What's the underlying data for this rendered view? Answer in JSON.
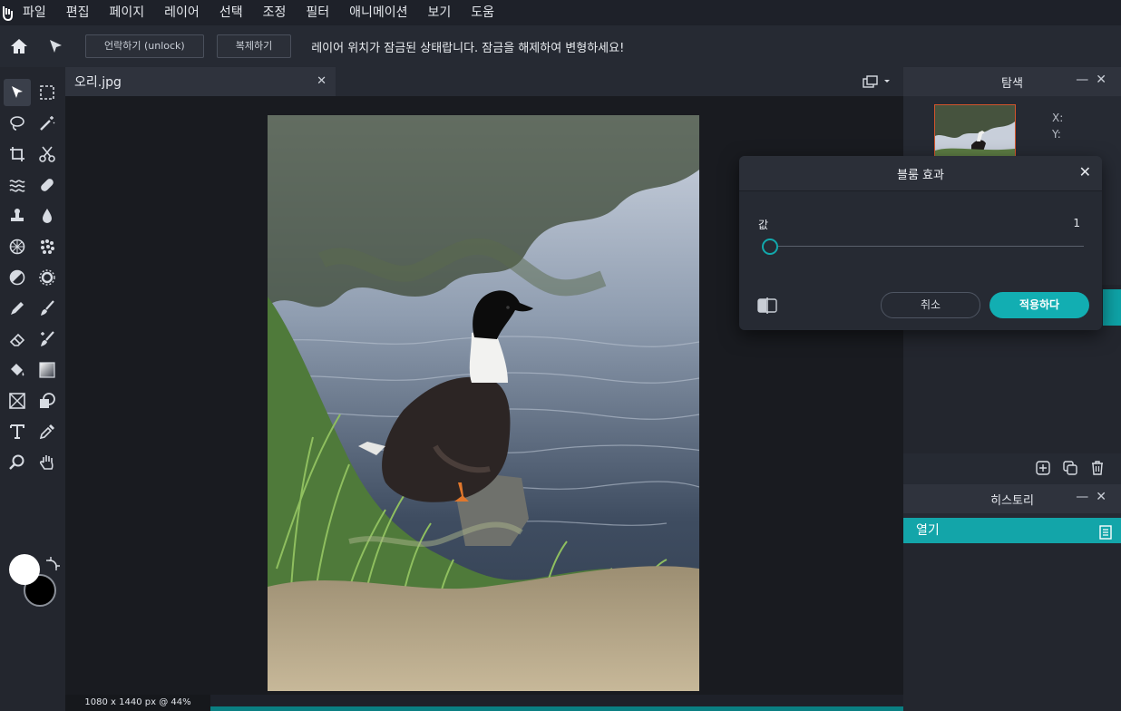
{
  "menu": [
    "파일",
    "편집",
    "페이지",
    "레이어",
    "선택",
    "조정",
    "필터",
    "애니메이션",
    "보기",
    "도움"
  ],
  "toolbar": {
    "unlock_label": "언락하기 (unlock)",
    "duplicate_label": "복제하기",
    "message": "레이어 위치가 잠금된 상태랍니다. 잠금을 해제하여 변형하세요!"
  },
  "document": {
    "tab_title": "오리.jpg",
    "status": "1080 x 1440 px @ 44%"
  },
  "navigator": {
    "title": "탐색",
    "x_label": "X:",
    "y_label": "Y:"
  },
  "history": {
    "title": "히스토리",
    "items": [
      "열기"
    ]
  },
  "dialog": {
    "title": "블룸 효과",
    "param_label": "값",
    "param_value": "1",
    "slider_fraction": 0.0,
    "cancel_label": "취소",
    "apply_label": "적용하다"
  },
  "colors": {
    "accent": "#12aeb2",
    "foreground": "#ffffff",
    "background": "#000000"
  }
}
